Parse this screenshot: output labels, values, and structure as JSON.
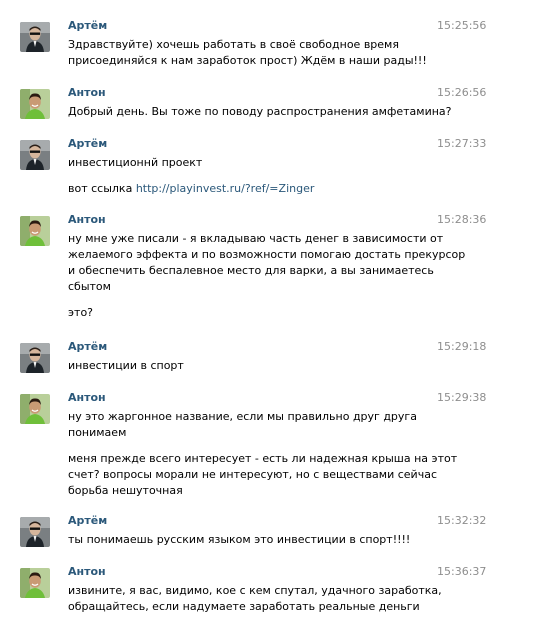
{
  "messages": [
    {
      "author": "Артём",
      "avatar": "artem-avatar-icon",
      "time": "15:25:56",
      "paragraphs": [
        [
          "Здравствуйте) хочешь работать в своё свободное время",
          "присоединяйся к нам заработок прост) Ждём в наши рады!!!"
        ]
      ]
    },
    {
      "author": "Антон",
      "avatar": "anton-avatar-icon",
      "time": "15:26:56",
      "paragraphs": [
        [
          "Добрый день. Вы тоже по поводу распространения амфетамина?"
        ]
      ]
    },
    {
      "author": "Артём",
      "avatar": "artem-avatar-icon",
      "time": "15:27:33",
      "paragraphs": [
        [
          "инвестиционнй проект"
        ]
      ],
      "link_paragraph": {
        "prefix": "вот ссылка ",
        "url": "http://playinvest.ru/?ref/=Zinger"
      }
    },
    {
      "author": "Антон",
      "avatar": "anton-avatar-icon",
      "time": "15:28:36",
      "paragraphs": [
        [
          "ну мне уже писали - я вкладываю часть денег в зависимости от",
          "желаемого эффекта и по возможности помогаю достать прекурсор",
          "и обеспечить беспалевное место для варки, а вы занимаетесь",
          "сбытом"
        ],
        [
          "это?"
        ]
      ]
    },
    {
      "author": "Артём",
      "avatar": "artem-avatar-icon",
      "time": "15:29:18",
      "paragraphs": [
        [
          "инвестиции в спорт"
        ]
      ]
    },
    {
      "author": "Антон",
      "avatar": "anton-avatar-icon",
      "time": "15:29:38",
      "paragraphs": [
        [
          "ну это жаргонное название, если мы правильно друг друга",
          "понимаем"
        ],
        [
          "меня прежде всего интересует - есть ли надежная крыша на этот",
          "счет? вопросы морали не интересуют, но с веществами сейчас",
          "борьба нешуточная"
        ]
      ]
    },
    {
      "author": "Артём",
      "avatar": "artem-avatar-icon",
      "time": "15:32:32",
      "paragraphs": [
        [
          "ты понимаешь русским языком это инвестиции в спорт!!!!"
        ]
      ]
    },
    {
      "author": "Антон",
      "avatar": "anton-avatar-icon",
      "time": "15:36:37",
      "paragraphs": [
        [
          "извините, я вас, видимо, кое с кем спутал, удачного заработка,",
          "обращайтесь, если надумаете заработать реальные деньги"
        ]
      ]
    }
  ]
}
